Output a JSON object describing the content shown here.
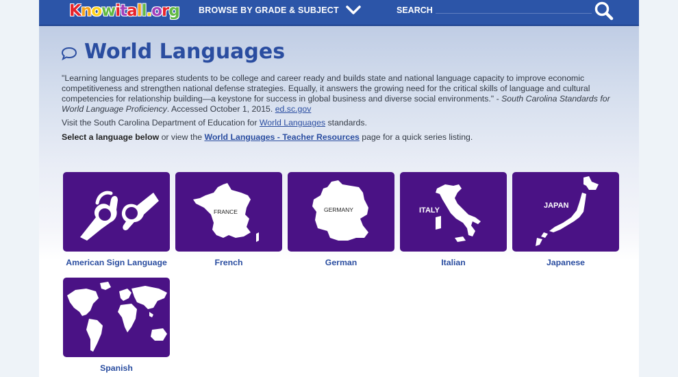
{
  "colors": {
    "nav": "#2c55a8",
    "title": "#2a4da0",
    "tile": "#4a1285",
    "link": "#2a4da0"
  },
  "header": {
    "logo_parts": [
      "K",
      "n",
      "o",
      "w",
      "i",
      "t",
      "a",
      "l",
      "l",
      ".",
      "o",
      "r",
      "g"
    ],
    "browse_label": "BROWSE BY GRADE & SUBJECT",
    "search_label": "SEARCH",
    "search_placeholder": ""
  },
  "page": {
    "title": "World Languages",
    "quote": "\"Learning languages prepares students to be college and career ready and builds state and national language capacity to improve economic competitiveness and strengthen national defense strategies. Equally, it answers the growing need for the critical skills of language and cultural competencies for relationship building—a keystone for success in global business and diverse social environments.\" - ",
    "quote_source": "South Carolina Standards for World Language Proficiency",
    "quote_accessed": ". Accessed October 1, 2015. ",
    "quote_link": "ed.sc.gov",
    "visit_prefix": "Visit the South Carolina Department of Education for ",
    "visit_link": "World Languages",
    "visit_suffix": " standards.",
    "select_bold": "Select a language below",
    "select_middle": " or view the ",
    "select_link": "World Languages - Teacher Resources",
    "select_suffix": " page for a quick series listing."
  },
  "languages": [
    {
      "name": "American Sign Language",
      "icon": "hands-sign-icon",
      "map_label": ""
    },
    {
      "name": "French",
      "icon": "france-map-icon",
      "map_label": "FRANCE"
    },
    {
      "name": "German",
      "icon": "germany-map-icon",
      "map_label": "GERMANY"
    },
    {
      "name": "Italian",
      "icon": "italy-map-icon",
      "map_label": "ITALY"
    },
    {
      "name": "Japanese",
      "icon": "japan-map-icon",
      "map_label": "JAPAN"
    },
    {
      "name": "Spanish",
      "icon": "world-map-icon",
      "map_label": ""
    }
  ]
}
